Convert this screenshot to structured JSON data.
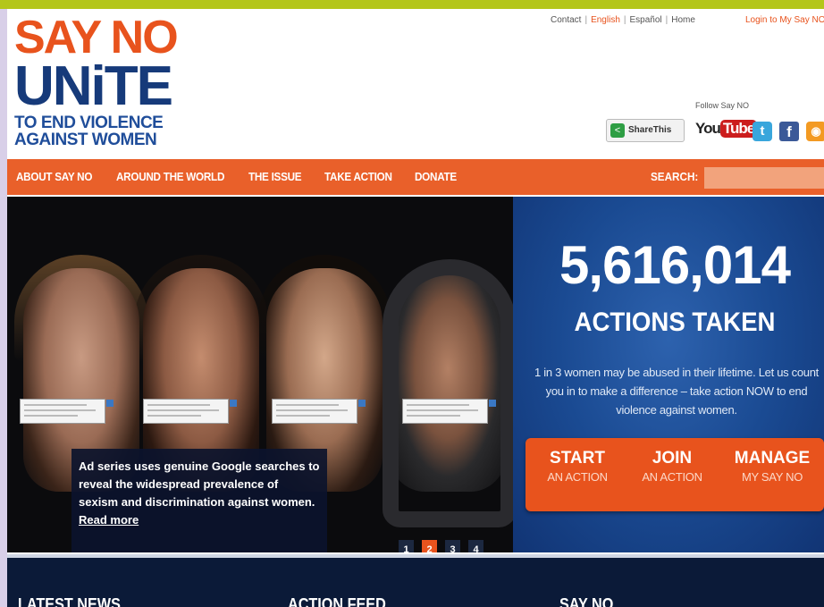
{
  "logo": {
    "line1": "SAY NO",
    "line2": "UNiTE",
    "line3": "TO END VIOLENCE",
    "line4": "AGAINST WOMEN"
  },
  "toplinks": [
    "Contact",
    "English",
    "Español",
    "Home"
  ],
  "login": "Login to My Say NO",
  "follow": "Follow Say NO",
  "share": {
    "label": "ShareThis"
  },
  "social": {
    "youtube_you": "You",
    "youtube_tube": "Tube",
    "twitter": "t",
    "facebook": "f",
    "rss": "◉"
  },
  "nav": {
    "items": [
      "ABOUT SAY NO",
      "AROUND THE WORLD",
      "THE ISSUE",
      "TAKE ACTION",
      "DONATE"
    ],
    "search_label": "SEARCH:"
  },
  "hero": {
    "caption": "Ad series uses genuine Google searches to reveal the widespread prevalence of sexism and discrimination against women.",
    "read_more": "Read more",
    "pages": [
      "1",
      "2",
      "3",
      "4"
    ],
    "active_page": "2"
  },
  "actions": {
    "count": "5,616,014",
    "label": "ACTIONS TAKEN",
    "blurb": "1 in 3 women may be abused in their lifetime. Let us count you in to make a difference – take action NOW to end violence against women.",
    "buttons": [
      {
        "big": "START",
        "small": "AN ACTION"
      },
      {
        "big": "JOIN",
        "small": "AN ACTION"
      },
      {
        "big": "MANAGE",
        "small": "MY SAY NO"
      }
    ]
  },
  "bottom": {
    "headings": [
      "LATEST NEWS",
      "ACTION FEED",
      "SAY NO"
    ]
  },
  "colors": {
    "accent": "#e8531d",
    "navy": "#163a7a",
    "lime": "#b4c61a",
    "panel_blue": "#1a4a92"
  }
}
